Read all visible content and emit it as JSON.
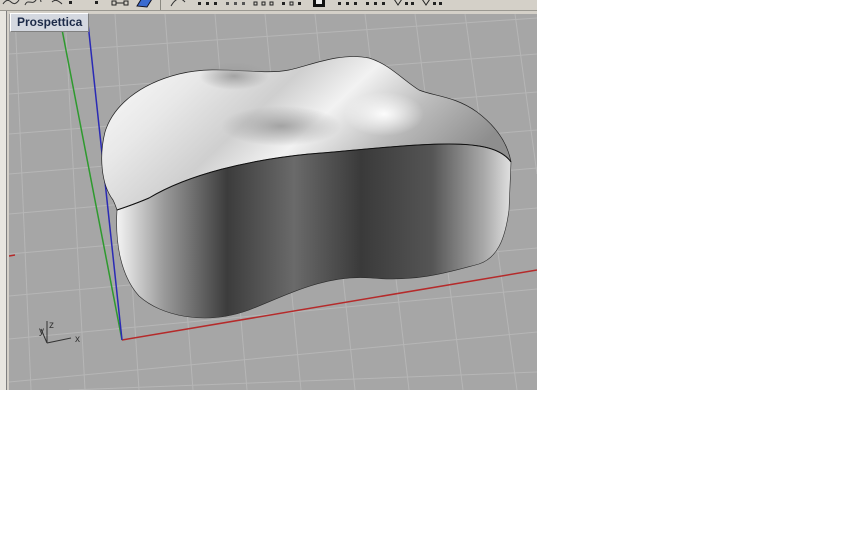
{
  "viewport": {
    "title": "Prospettica",
    "axis_labels": {
      "x": "x",
      "y": "y",
      "z": "z"
    },
    "colors": {
      "background": "#a6a6a6",
      "grid": "#b9b9b9",
      "x_axis": "#b52a2a",
      "y_axis": "#2e9a2e",
      "z_axis": "#2a2ab5"
    }
  },
  "toolbar": {
    "icons": [
      "curve-icon",
      "freeform-curve-icon",
      "point-icon",
      "line-icon",
      "snap-icon",
      "select-object-icon",
      "surface-icon",
      "grid-snap-icon",
      "ortho-icon",
      "planar-icon",
      "osnap-icon",
      "snap-point-icon",
      "render-icon",
      "snap-end-icon",
      "snap-mid-icon",
      "snap-cen-icon",
      "snap-int-icon"
    ]
  }
}
